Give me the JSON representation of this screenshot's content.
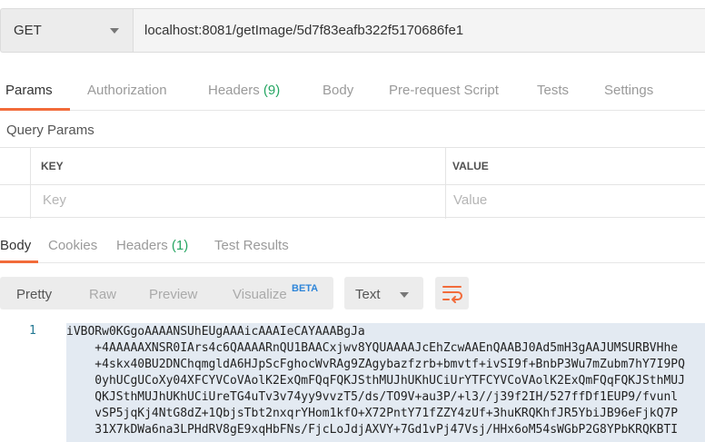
{
  "request": {
    "method": "GET",
    "url": "localhost:8081/getImage/5d7f83eafb322f5170686fe1"
  },
  "request_tabs": [
    {
      "label": "Params",
      "active": true
    },
    {
      "label": "Authorization"
    },
    {
      "label": "Headers",
      "count": "(9)"
    },
    {
      "label": "Body"
    },
    {
      "label": "Pre-request Script"
    },
    {
      "label": "Tests"
    },
    {
      "label": "Settings"
    }
  ],
  "query_params": {
    "title": "Query Params",
    "key_header": "KEY",
    "value_header": "VALUE",
    "key_placeholder": "Key",
    "value_placeholder": "Value"
  },
  "response_tabs": [
    {
      "label": "Body",
      "active": true
    },
    {
      "label": "Cookies"
    },
    {
      "label": "Headers",
      "count": "(1)"
    },
    {
      "label": "Test Results"
    }
  ],
  "view_modes": {
    "pretty": "Pretty",
    "raw": "Raw",
    "preview": "Preview",
    "visualize": "Visualize",
    "beta": "BETA"
  },
  "format_select": "Text",
  "wrap_icon": "wrap-lines-icon",
  "response_body": {
    "line_number": "1",
    "lines": [
      "iVBORw0KGgoAAAANSUhEUgAAAicAAAIeCAYAAABgJa",
      "    +4AAAAAXNSR0IArs4c6QAAAARnQU1BAACxjwv8YQUAAAAJcEhZcwAAEnQAABJ0Ad5mH3gAAJUMSURBVHhe",
      "    +4skx40BU2DNChqmgldA6HJpScFghocWvRAg9ZAgybazfzrb+bmvtf+ivSI9f+BnbP3Wu7mZubm7hY7I9PQ",
      "    0yhUCgUCoXy04XFCYVCoVAolK2ExQmFQqFQKJSthMUJhUKhUCiUrYTFCYVCoVAolK2ExQmFQqFQKJSthMUJ",
      "    QKJSthMUJhUKhUCiUreTG4uTv3v74yy9vvzT5/ds/TO9V+au3P/+l3//j39f2IH/527ffDf1EUP9/fvunl",
      "    vSP5jqKj4NtG8dZ+1QbjsTbt2nxqrYHom1kfO+X72PntY71fZZY4zUf+3huKRQKhfJR5YbiJB96eFjkQ7P",
      "    31X7kDWa6na3LPHdRV8gE9xqHbFNs/FjcLoJdjAXVY+7Gd1vPj47Vsj/HHx6oM54sWGbP2G8YPbKRQKBTI"
    ]
  }
}
